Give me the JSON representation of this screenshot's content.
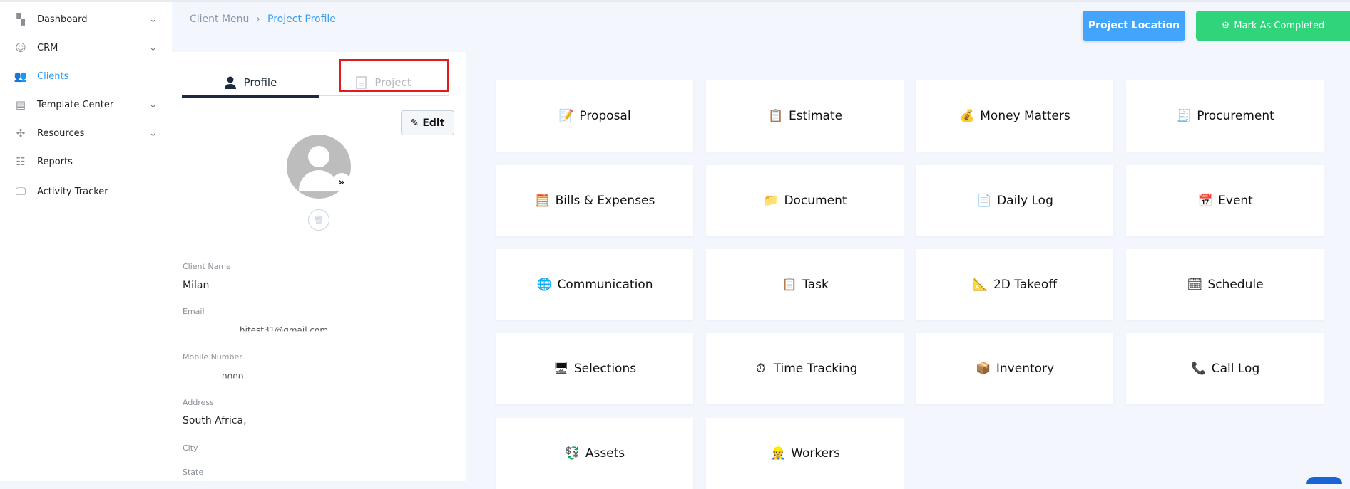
{
  "sidebar": {
    "items": [
      {
        "label": "Dashboard",
        "icon": "dashboard-icon",
        "chevron": true
      },
      {
        "label": "CRM",
        "icon": "crm-icon",
        "chevron": true
      },
      {
        "label": "Clients",
        "icon": "clients-icon",
        "active": true
      },
      {
        "label": "Template Center",
        "icon": "template-icon",
        "chevron": true
      },
      {
        "label": "Resources",
        "icon": "resources-icon",
        "chevron": true
      },
      {
        "label": "Reports",
        "icon": "reports-icon"
      },
      {
        "label": "Activity Tracker",
        "icon": "activity-icon"
      }
    ]
  },
  "breadcrumb": {
    "parent": "Client Menu",
    "current": "Project Profile"
  },
  "actions": {
    "project_location": "Project Location",
    "mark_completed": "Mark As Completed"
  },
  "colors": {
    "accent": "#3d9df3",
    "location_button": "#42a5fb",
    "completed_button": "#2fd47b",
    "highlight": "#e01b1b"
  },
  "tabs": {
    "profile": "Profile",
    "project": "Project"
  },
  "profile": {
    "edit_label": "Edit",
    "fields": [
      {
        "label": "Client Name",
        "value": "Milan"
      },
      {
        "label": "Email",
        "value": "hitest31@gmail.com"
      },
      {
        "label": "Mobile Number",
        "value": "0000"
      },
      {
        "label": "Address",
        "value": "South Africa,"
      },
      {
        "label": "City",
        "value": ""
      },
      {
        "label": "State",
        "value": ""
      }
    ]
  },
  "modules": [
    {
      "label": "Proposal",
      "icon": "proposal-icon"
    },
    {
      "label": "Estimate",
      "icon": "estimate-icon"
    },
    {
      "label": "Money Matters",
      "icon": "money-icon"
    },
    {
      "label": "Procurement",
      "icon": "procurement-icon"
    },
    {
      "label": "Bills & Expenses",
      "icon": "calculator-icon"
    },
    {
      "label": "Document",
      "icon": "folder-icon"
    },
    {
      "label": "Daily Log",
      "icon": "log-icon"
    },
    {
      "label": "Event",
      "icon": "calendar-icon"
    },
    {
      "label": "Communication",
      "icon": "communication-icon"
    },
    {
      "label": "Task",
      "icon": "task-icon"
    },
    {
      "label": "2D Takeoff",
      "icon": "takeoff-icon"
    },
    {
      "label": "Schedule",
      "icon": "schedule-icon"
    },
    {
      "label": "Selections",
      "icon": "selections-icon"
    },
    {
      "label": "Time Tracking",
      "icon": "time-icon"
    },
    {
      "label": "Inventory",
      "icon": "inventory-icon"
    },
    {
      "label": "Call Log",
      "icon": "phone-icon"
    },
    {
      "label": "Assets",
      "icon": "assets-icon"
    },
    {
      "label": "Workers",
      "icon": "worker-icon"
    }
  ]
}
